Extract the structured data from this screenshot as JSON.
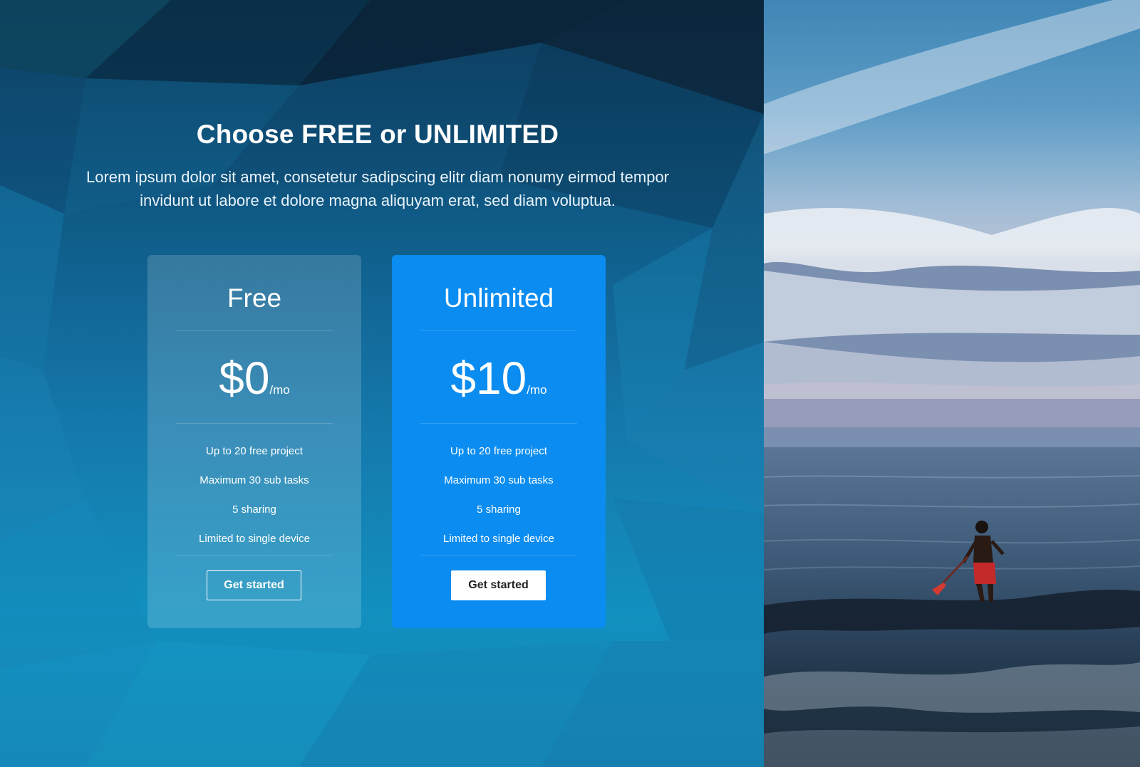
{
  "hero": {
    "title": "Choose FREE or UNLIMITED",
    "lead_line1": "Lorem ipsum dolor sit amet, consetetur sadipscing elitr diam nonumy eirmod tempor",
    "lead_line2": "invidunt ut labore et dolore magna aliquyam erat, sed diam voluptua."
  },
  "plans": [
    {
      "name": "Free",
      "price": "$0",
      "period": "/mo",
      "features": [
        "Up to 20 free project",
        "Maximum 30 sub tasks",
        "5 sharing",
        "Limited to single device"
      ],
      "cta": "Get started"
    },
    {
      "name": "Unlimited",
      "price": "$10",
      "period": "/mo",
      "features": [
        "Up to 20 free project",
        "Maximum 30 sub tasks",
        "5 sharing",
        "Limited to single device"
      ],
      "cta": "Get started"
    }
  ],
  "colors": {
    "accent": "#0a8cf0",
    "background_top": "#0b2f4a",
    "background_bottom": "#1290bf",
    "text": "#ffffff",
    "button_text_dark": "#222222"
  },
  "images": {
    "right_photo": "paddleboarder-in-ocean-at-dusk"
  }
}
